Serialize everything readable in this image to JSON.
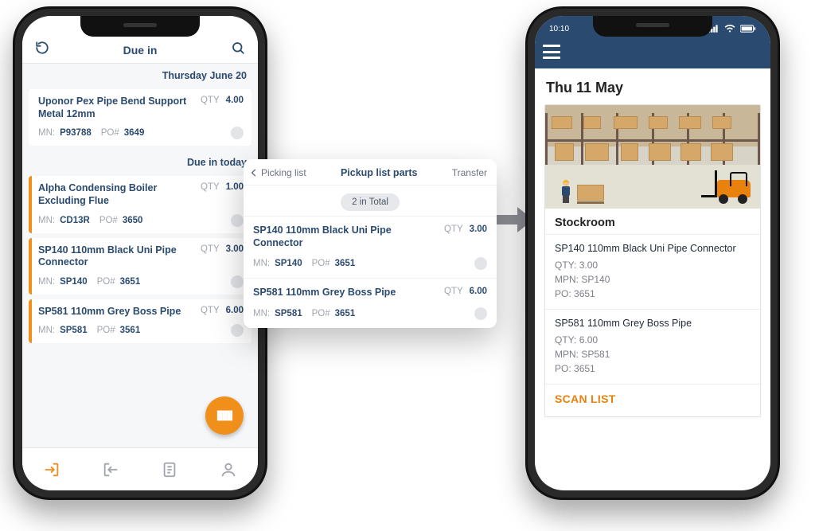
{
  "left_phone": {
    "header": {
      "title": "Due in"
    },
    "sections": [
      {
        "heading": "Thursday June 20",
        "items": [
          {
            "name": "Uponor Pex Pipe Bend Support Metal 12mm",
            "qty_label": "QTY",
            "qty": "4.00",
            "mn_label": "MN:",
            "mn": "P93788",
            "po_label": "PO#",
            "po": "3649",
            "highlight": false
          }
        ]
      },
      {
        "heading": "Due in today",
        "items": [
          {
            "name": "Alpha Condensing Boiler Excluding Flue",
            "qty_label": "QTY",
            "qty": "1.00",
            "mn_label": "MN:",
            "mn": "CD13R",
            "po_label": "PO#",
            "po": "3650",
            "highlight": true
          },
          {
            "name": "SP140 110mm Black Uni Pipe Connector",
            "qty_label": "QTY",
            "qty": "3.00",
            "mn_label": "MN:",
            "mn": "SP140",
            "po_label": "PO#",
            "po": "3651",
            "highlight": true
          },
          {
            "name": "SP581 110mm Grey Boss Pipe",
            "qty_label": "QTY",
            "qty": "6.00",
            "mn_label": "MN:",
            "mn": "SP581",
            "po_label": "PO#",
            "po": "3561",
            "highlight": true
          }
        ]
      }
    ]
  },
  "float_card": {
    "back_label": "Picking list",
    "title": "Pickup list parts",
    "transfer_label": "Transfer",
    "count_label": "2 in Total",
    "items": [
      {
        "name": "SP140 110mm Black Uni Pipe Connector",
        "qty_label": "QTY",
        "qty": "3.00",
        "mn_label": "MN:",
        "mn": "SP140",
        "po_label": "PO#",
        "po": "3651"
      },
      {
        "name": "SP581 110mm Grey Boss Pipe",
        "qty_label": "QTY",
        "qty": "6.00",
        "mn_label": "MN:",
        "mn": "SP581",
        "po_label": "PO#",
        "po": "3651"
      }
    ]
  },
  "right_phone": {
    "status": {
      "time": "10:10"
    },
    "date": "Thu 11 May",
    "card": {
      "location": "Stockroom",
      "items": [
        {
          "title": "SP140 110mm Black Uni Pipe Connector",
          "qty_label": "QTY:",
          "qty": "3.00",
          "mpn_label": "MPN:",
          "mpn": "SP140",
          "po_label": "PO:",
          "po": "3651"
        },
        {
          "title": "SP581 110mm Grey Boss Pipe",
          "qty_label": "QTY:",
          "qty": "6.00",
          "mpn_label": "MPN:",
          "mpn": "SP581",
          "po_label": "PO:",
          "po": "3651"
        }
      ],
      "scan_label": "SCAN LIST"
    }
  }
}
